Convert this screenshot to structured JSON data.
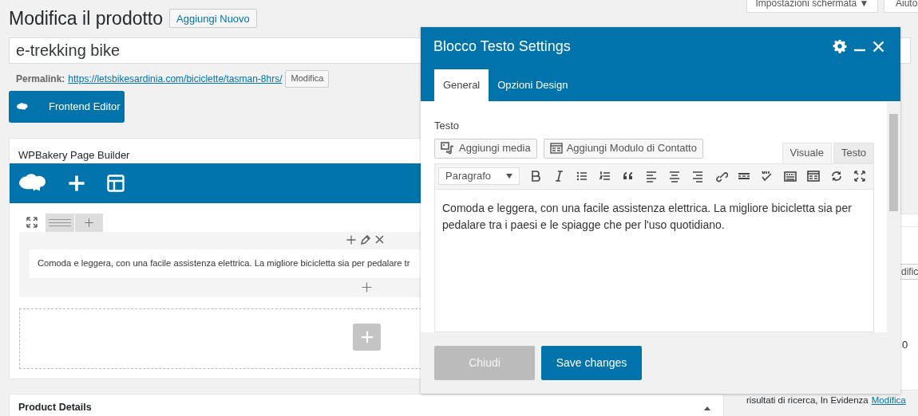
{
  "screen_options": {
    "label": "Impostazioni schermata ▼"
  },
  "help": {
    "label": "Aiuto"
  },
  "page_title": "Modifica il prodotto",
  "add_new": "Aggiungi Nuovo",
  "title_field": {
    "value": "e-trekking bike"
  },
  "permalink": {
    "label": "Permalink:",
    "url": "https://letsbikesardinia.com/biciclette/tasman-8hrs/",
    "edit": "Modifica"
  },
  "frontend_editor": "Frontend Editor",
  "page_builder": {
    "title": "WPBakery Page Builder",
    "element_text": "Comoda e leggera, con una facile assistenza elettrica. La migliore bicicletta sia per pedalare tr"
  },
  "product_details": {
    "title": "Product Details",
    "expanded": true
  },
  "sidebar": {
    "button": "dific",
    "value": "0",
    "text": "risultati di ricerca, In Evidenza",
    "link": "Modifica"
  },
  "dialog": {
    "title": "Blocco Testo Settings",
    "tabs": [
      {
        "label": "General",
        "selected": true
      },
      {
        "label": "Opzioni Design",
        "selected": false
      }
    ],
    "field_label": "Testo",
    "media_buttons": [
      {
        "kind": "media",
        "label": "Aggiungi media"
      },
      {
        "kind": "form",
        "label": "Aggiungi Modulo di Contatto"
      }
    ],
    "editor_tabs": [
      {
        "label": "Visuale",
        "selected": true
      },
      {
        "label": "Testo",
        "selected": false
      }
    ],
    "format": "Paragrafo",
    "content": "Comoda e leggera, con una facile assistenza elettrica. La migliore bicicletta sia per pedalare tra i paesi e le spiagge che per l'uso quotidiano.",
    "buttons": [
      {
        "kind": "secondary",
        "label": "Chiudi"
      },
      {
        "kind": "primary",
        "label": "Save changes"
      }
    ]
  }
}
